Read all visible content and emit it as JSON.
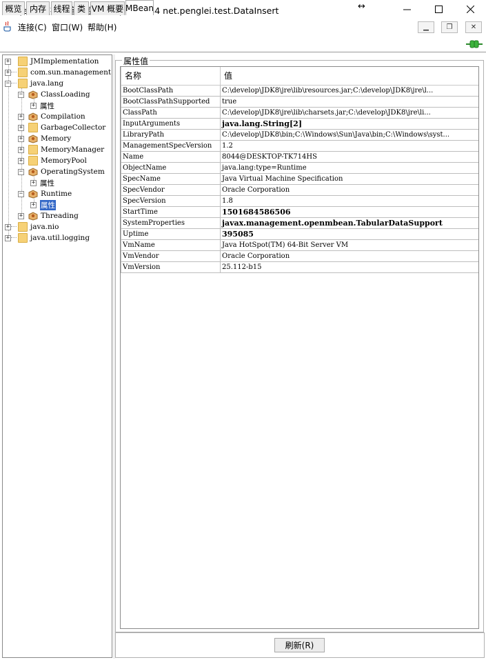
{
  "window": {
    "title": "Java 监视和管理控制台 - pid: 8044 net.penglei.test.DataInsert"
  },
  "menu": {
    "items": [
      "连接(C)",
      "窗口(W)",
      "帮助(H)"
    ]
  },
  "tabs": [
    "概览",
    "内存",
    "线程",
    "类",
    "VM 概要",
    "MBean"
  ],
  "tree": {
    "nodes": [
      "JMImplementation",
      "com.sun.management",
      "java.lang",
      "ClassLoading",
      "属性",
      "Compilation",
      "GarbageCollector",
      "Memory",
      "MemoryManager",
      "MemoryPool",
      "OperatingSystem",
      "属性",
      "Runtime",
      "属性",
      "Threading",
      "java.nio",
      "java.util.logging"
    ]
  },
  "attributes": {
    "group_title": "属性值",
    "col_name": "名称",
    "col_value": "值",
    "rows": [
      {
        "name": "BootClassPath",
        "value": "C:\\develop\\JDK8\\jre\\lib\\resources.jar;C:\\develop\\JDK8\\jre\\l..."
      },
      {
        "name": "BootClassPathSupported",
        "value": "true"
      },
      {
        "name": "ClassPath",
        "value": "C:\\develop\\JDK8\\jre\\lib\\charsets.jar;C:\\develop\\JDK8\\jre\\li..."
      },
      {
        "name": "InputArguments",
        "value": "java.lang.String[2]"
      },
      {
        "name": "LibraryPath",
        "value": "C:\\develop\\JDK8\\bin;C:\\Windows\\Sun\\Java\\bin;C:\\Windows\\syst..."
      },
      {
        "name": "ManagementSpecVersion",
        "value": "1.2"
      },
      {
        "name": "Name",
        "value": "8044@DESKTOP-TK714HS"
      },
      {
        "name": "ObjectName",
        "value": "java.lang:type=Runtime"
      },
      {
        "name": "SpecName",
        "value": "Java Virtual Machine Specification"
      },
      {
        "name": "SpecVendor",
        "value": "Oracle Corporation"
      },
      {
        "name": "SpecVersion",
        "value": "1.8"
      },
      {
        "name": "StartTime",
        "value": "1501684586506"
      },
      {
        "name": "SystemProperties",
        "value": "javax.management.openmbean.TabularDataSupport"
      },
      {
        "name": "Uptime",
        "value": "395085"
      },
      {
        "name": "VmName",
        "value": "Java HotSpot(TM) 64-Bit Server VM"
      },
      {
        "name": "VmVendor",
        "value": "Oracle Corporation"
      },
      {
        "name": "VmVersion",
        "value": "25.112-b15"
      }
    ]
  },
  "refresh_label": "刷新(R)"
}
